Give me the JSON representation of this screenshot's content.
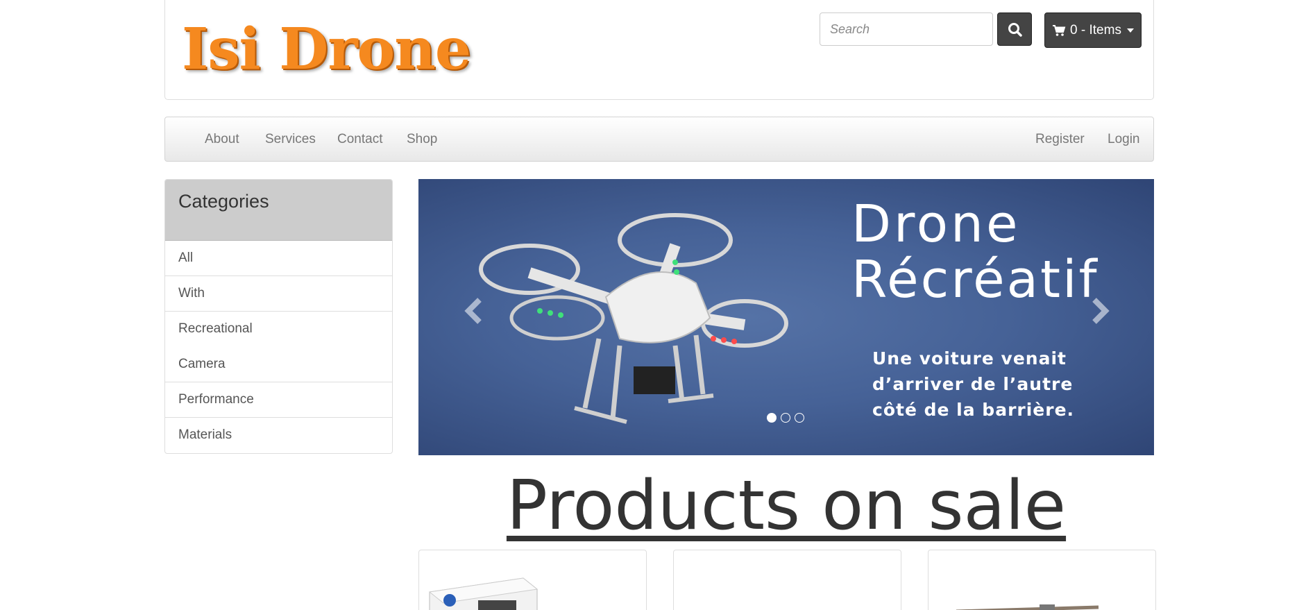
{
  "header": {
    "logo_text": "Isi Drone",
    "search_placeholder": "Search",
    "cart_label": "0 - Items"
  },
  "nav": {
    "left": [
      "About",
      "Services",
      "Contact",
      "Shop"
    ],
    "right": [
      "Register",
      "Login"
    ]
  },
  "sidebar": {
    "title": "Categories",
    "items": [
      "All",
      "With",
      "Recreational",
      "Camera",
      "Performance",
      "Materials"
    ]
  },
  "carousel": {
    "title_line1": "Drone",
    "title_line2": "Récréatif",
    "subtitle_line1": "Une voiture venait",
    "subtitle_line2": "d’arriver de l’autre",
    "subtitle_line3": "côté de la barrière.",
    "slide_count": 3,
    "active_slide": 1
  },
  "products": {
    "heading": "Products on sale"
  },
  "colors": {
    "logo": "#f5891f",
    "dark_button": "#444444",
    "carousel_bg": "#4a659a",
    "sidebar_header": "#cccccc"
  }
}
